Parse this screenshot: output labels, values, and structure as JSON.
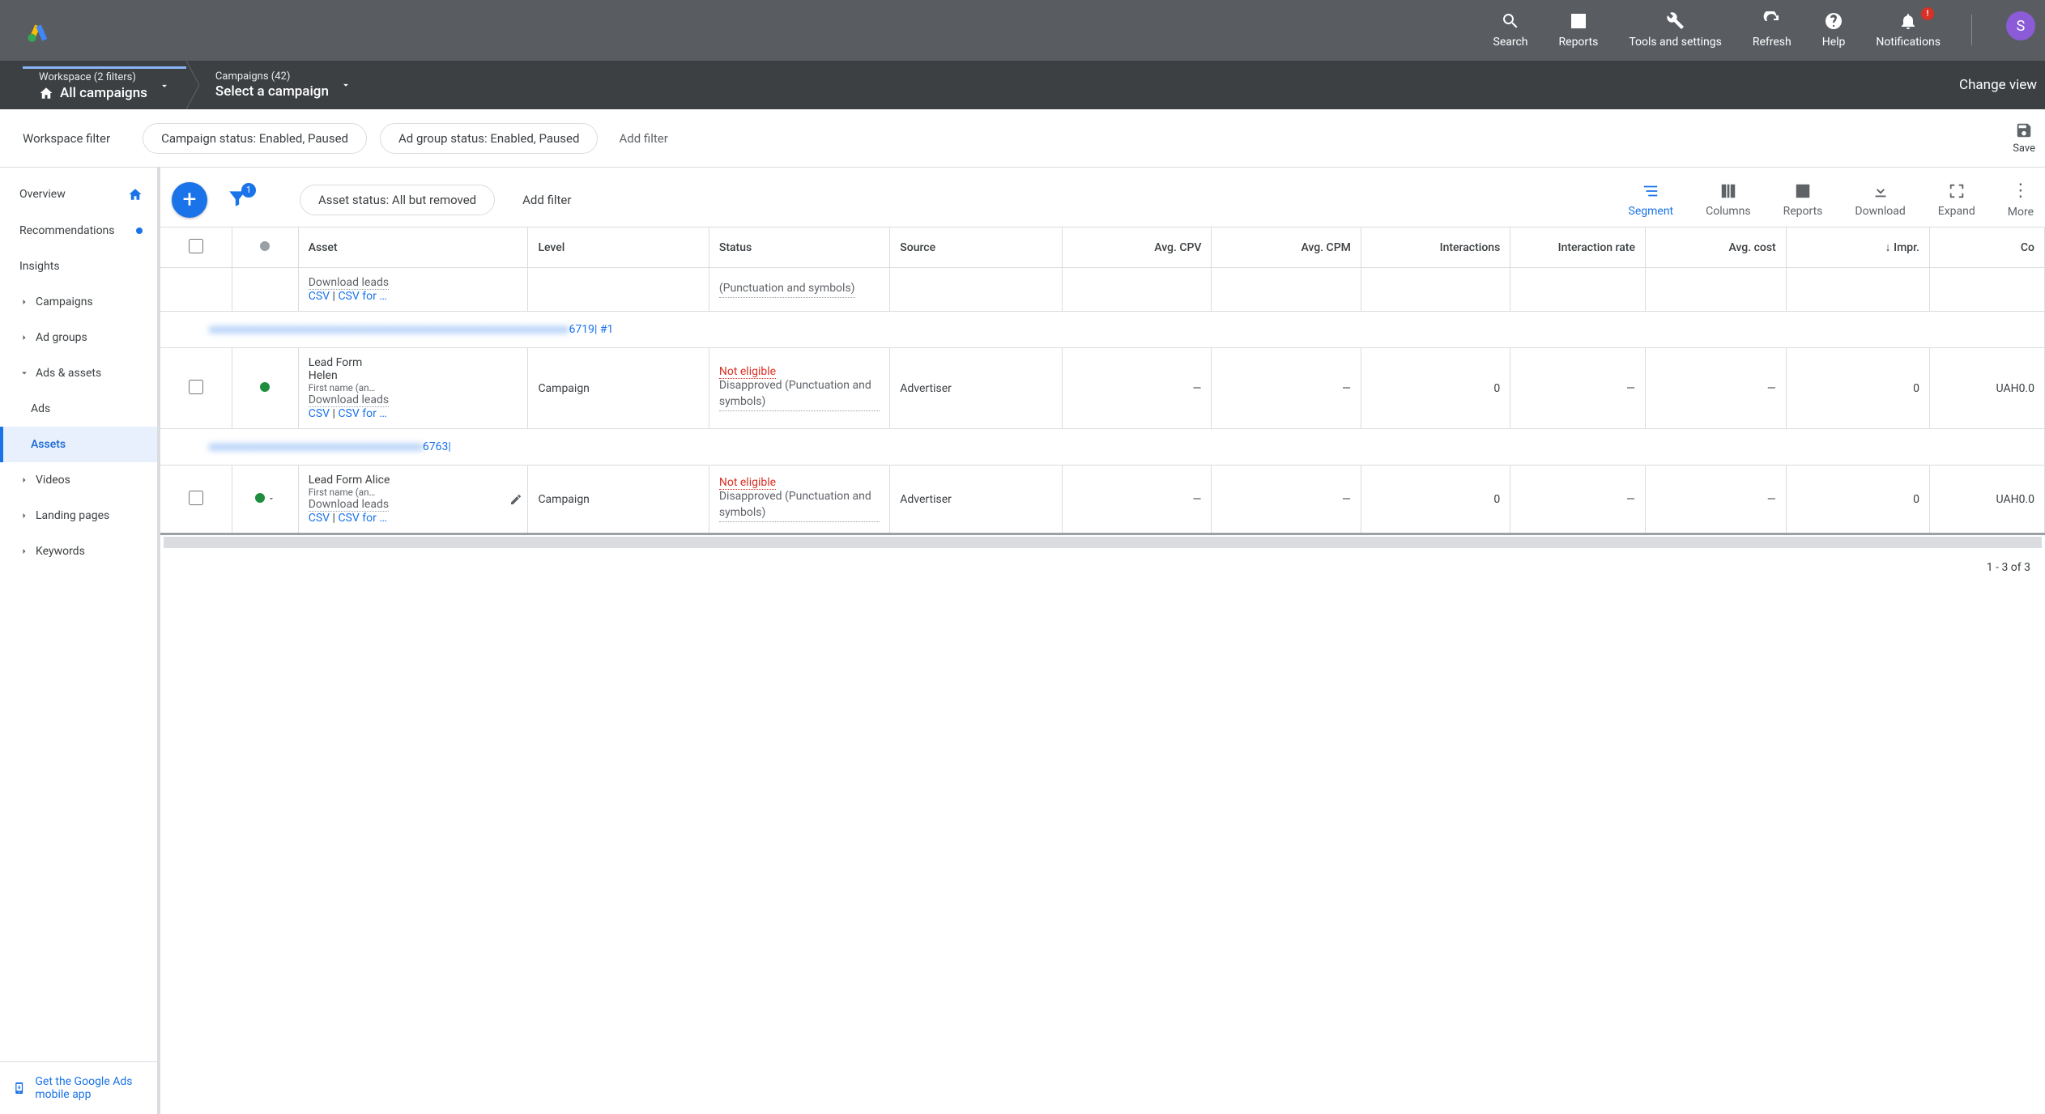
{
  "topbar": {
    "icons": {
      "search": "Search",
      "reports": "Reports",
      "tools": "Tools and settings",
      "refresh": "Refresh",
      "help": "Help",
      "notifications": "Notifications",
      "notif_badge": "!"
    },
    "avatar_initial": "S"
  },
  "crumbs": {
    "workspace_top": "Workspace (2 filters)",
    "workspace_main": "All campaigns",
    "campaigns_top": "Campaigns (42)",
    "campaigns_main": "Select a campaign",
    "change_view": "Change view"
  },
  "filterbar": {
    "label": "Workspace filter",
    "chip1": "Campaign status: Enabled, Paused",
    "chip2": "Ad group status: Enabled, Paused",
    "add": "Add filter",
    "save": "Save"
  },
  "sidebar": {
    "overview": "Overview",
    "recommendations": "Recommendations",
    "insights": "Insights",
    "campaigns": "Campaigns",
    "adgroups": "Ad groups",
    "adsassets": "Ads & assets",
    "ads": "Ads",
    "assets": "Assets",
    "videos": "Videos",
    "landing": "Landing pages",
    "keywords": "Keywords",
    "footer": "Get the Google Ads mobile app"
  },
  "toolbar": {
    "asset_pill": "Asset status: All but removed",
    "add_filter": "Add filter",
    "filter_badge": "1",
    "segment": "Segment",
    "columns": "Columns",
    "reports": "Reports",
    "download": "Download",
    "expand": "Expand",
    "more": "More"
  },
  "columns": {
    "checkbox": "",
    "status": "",
    "asset": "Asset",
    "level": "Level",
    "statuscol": "Status",
    "source": "Source",
    "avgcpv": "Avg. CPV",
    "avgcpm": "Avg. CPM",
    "interactions": "Interactions",
    "interactionrate": "Interaction rate",
    "avgcost": "Avg. cost",
    "impr": "Impr.",
    "conv": "Co"
  },
  "rows": {
    "r0": {
      "asset_l2": "Download leads",
      "asset_csv": "CSV",
      "asset_pipe": " | ",
      "asset_csvfor": "CSV for …",
      "status_sub": "(Punctuation and symbols)"
    },
    "group1_blur": "xxxxxxxxxxxxxxxxxxxxxxxxxxxxxxxxxxxxxxxxxxxxxxxxxxxxxxxxxxxxxxxx",
    "group1_tail": "6719| #1",
    "r1": {
      "asset_l1": "Lead Form",
      "asset_l2": "Helen",
      "asset_l3": "First name (an…",
      "asset_l4": "Download leads",
      "asset_csv": "CSV",
      "asset_pipe": " | ",
      "asset_csvfor": "CSV for …",
      "level": "Campaign",
      "status_err": "Not eligible",
      "status_sub": "Disapproved (Punctuation and symbols)",
      "source": "Advertiser",
      "avgcpv": "—",
      "avgcpm": "—",
      "interactions": "0",
      "interactionrate": "—",
      "avgcost": "—",
      "impr": "0",
      "conv": "UAH0.0"
    },
    "group2_blur": "xxxxxxxxxxxxxxxxxxxxxxxxxxxxxxxxxxxxxx",
    "group2_tail": "6763|",
    "r2": {
      "asset_l1": "Lead Form Alice",
      "asset_l2": "First name (an…",
      "asset_l3": "Download leads",
      "asset_csv": "CSV",
      "asset_pipe": " | ",
      "asset_csvfor": "CSV for …",
      "level": "Campaign",
      "status_err": "Not eligible",
      "status_sub": "Disapproved (Punctuation and symbols)",
      "source": "Advertiser",
      "avgcpv": "—",
      "avgcpm": "—",
      "interactions": "0",
      "interactionrate": "—",
      "avgcost": "—",
      "impr": "0",
      "conv": "UAH0.0"
    }
  },
  "pager": "1 - 3 of 3"
}
